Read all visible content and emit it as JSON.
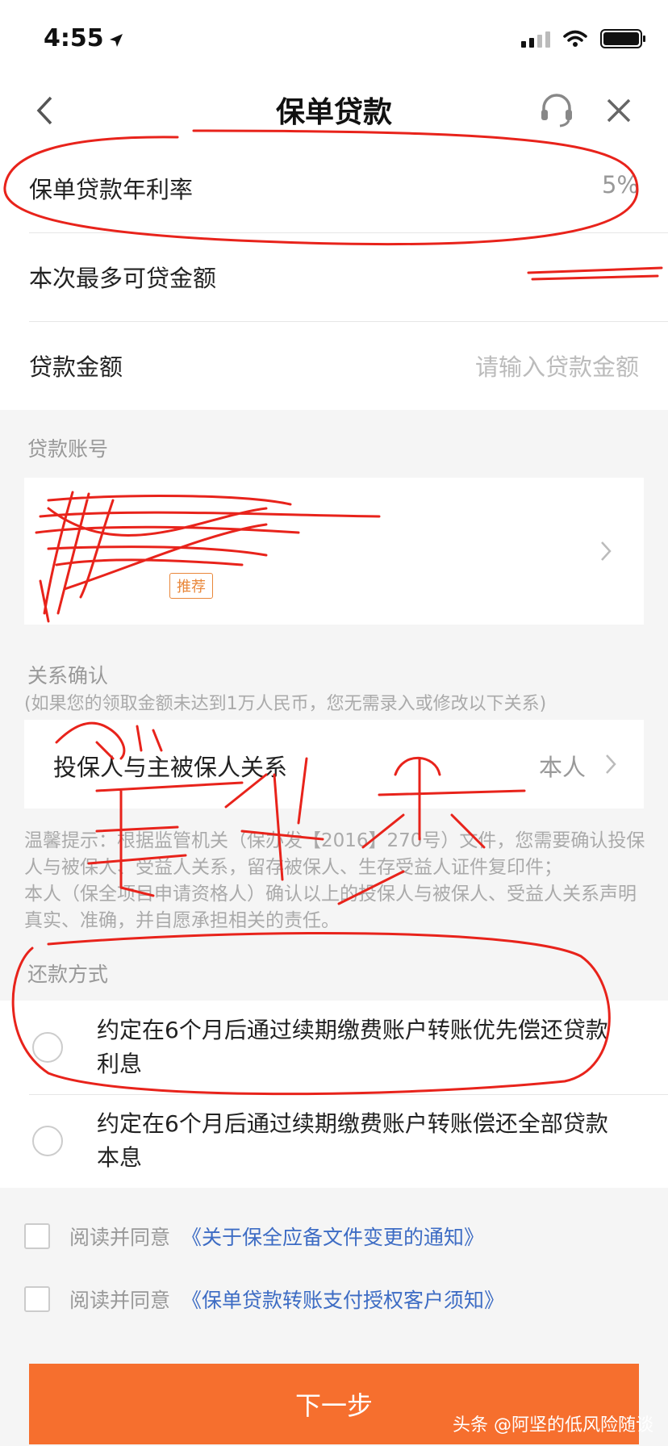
{
  "status_bar": {
    "time": "4:55",
    "location_icon": "location-arrow-icon",
    "signal_icon": "cellular-signal-icon",
    "wifi_icon": "wifi-icon",
    "battery_icon": "battery-icon"
  },
  "nav": {
    "title": "保单贷款",
    "back_icon": "chevron-left-icon",
    "support_icon": "headset-icon",
    "close_icon": "close-icon"
  },
  "loan_info": {
    "rate_label": "保单贷款年利率",
    "rate_value": "5%",
    "max_label": "本次最多可贷金额",
    "amount_label": "贷款金额",
    "amount_placeholder": "请输入贷款金额"
  },
  "account": {
    "section_label": "贷款账号",
    "badge": "推荐"
  },
  "relation": {
    "section_label": "关系确认",
    "hint": "(如果您的领取金额未达到1万人民币，您无需录入或修改以下关系)",
    "row_label": "投保人与主被保人关系",
    "row_value": "本人",
    "tip_line1": "温馨提示：根据监管机关（保办发【2016】270号）文件，您需要确认投保人与被保人、受益人关系，留存被保人、生存受益人证件复印件；",
    "tip_line2": "本人（保全项目申请资格人）确认以上的投保人与被保人、受益人关系声明真实、准确，并自愿承担相关的责任。"
  },
  "repayment": {
    "section_label": "还款方式",
    "options": [
      {
        "text": "约定在6个月后通过续期缴费账户转账优先偿还贷款利息"
      },
      {
        "text": "约定在6个月后通过续期缴费账户转账偿还全部贷款本息"
      }
    ]
  },
  "agreements": [
    {
      "prefix": "阅读并同意",
      "link": "《关于保全应备文件变更的通知》"
    },
    {
      "prefix": "阅读并同意",
      "link": "《保单贷款转账支付授权客户须知》"
    }
  ],
  "actions": {
    "next_label": "下一步"
  },
  "watermark": "头条 @阿坚的低风险随谈",
  "colors": {
    "accent": "#f66f2e",
    "link": "#3d6cc4",
    "badge": "#e9873a",
    "annotation": "#e8231b"
  }
}
